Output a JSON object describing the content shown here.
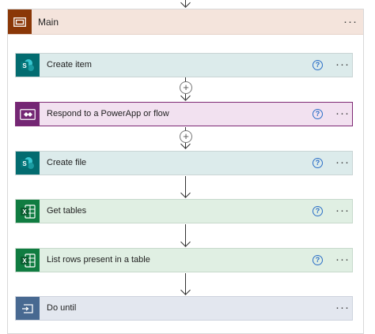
{
  "scope": {
    "title": "Main",
    "menu_label": "···"
  },
  "actions": [
    {
      "label": "Create item",
      "icon": "sharepoint-icon",
      "color": "#036c70",
      "has_help": true
    },
    {
      "label": "Respond to a PowerApp or flow",
      "icon": "powerapps-icon",
      "color": "#742774",
      "has_help": true
    },
    {
      "label": "Create file",
      "icon": "sharepoint-icon",
      "color": "#036c70",
      "has_help": true
    },
    {
      "label": "Get tables",
      "icon": "excel-icon",
      "color": "#107c41",
      "has_help": true
    },
    {
      "label": "List rows present in a table",
      "icon": "excel-icon",
      "color": "#107c41",
      "has_help": true
    },
    {
      "label": "Do until",
      "icon": "loop-icon",
      "color": "#486991",
      "has_help": false
    }
  ],
  "help_symbol": "?",
  "menu_symbol": "···",
  "plus_symbol": "+",
  "sharepoint_letter": "S",
  "excel_letter": "X"
}
